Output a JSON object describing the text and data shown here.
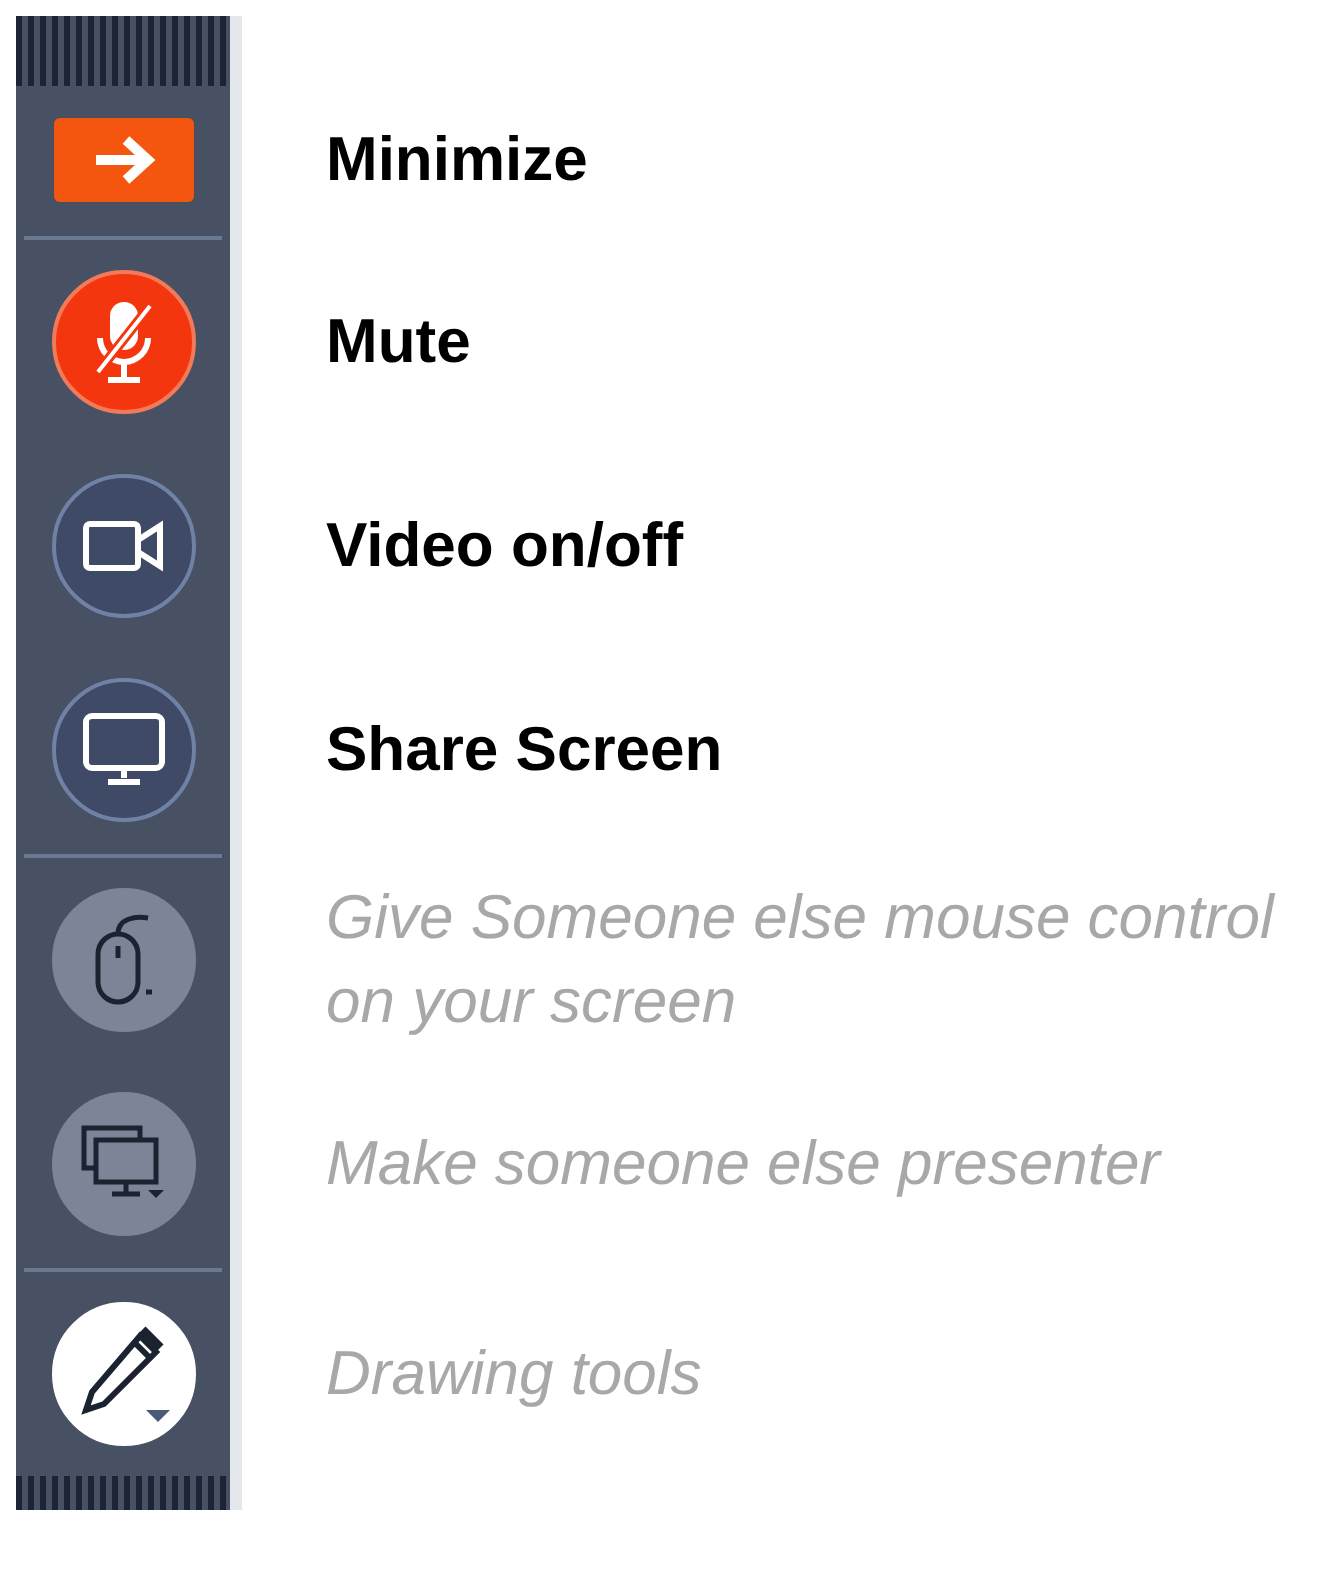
{
  "toolbar": {
    "groups": [
      {
        "items": [
          {
            "kind": "minimize",
            "label": "Minimize",
            "disabled": false
          }
        ]
      },
      {
        "items": [
          {
            "kind": "microphone",
            "label": "Mute",
            "disabled": false,
            "on": true
          },
          {
            "kind": "camera",
            "label": "Video on/off",
            "disabled": false,
            "on": false
          },
          {
            "kind": "monitor",
            "label": "Share Screen",
            "disabled": false,
            "on": false
          }
        ]
      },
      {
        "items": [
          {
            "kind": "mouse",
            "label": "Give Someone else mouse control on your screen",
            "disabled": true
          },
          {
            "kind": "screens",
            "label": "Make someone else presenter",
            "disabled": true
          }
        ]
      },
      {
        "items": [
          {
            "kind": "pen",
            "label": "Drawing tools",
            "disabled": true
          }
        ]
      }
    ]
  }
}
